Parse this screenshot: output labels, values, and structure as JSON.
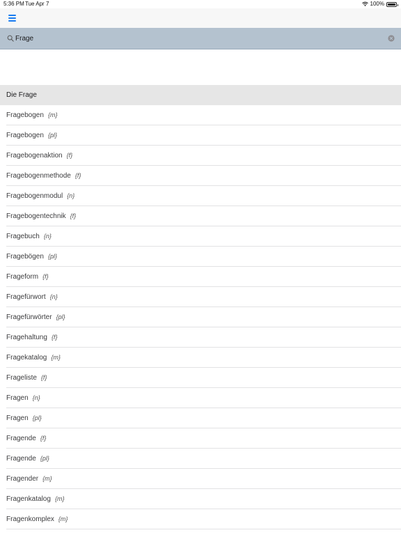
{
  "status_bar": {
    "time": "5:36 PM",
    "date": "Tue Apr 7",
    "battery": "100%"
  },
  "search": {
    "value": "Frage",
    "placeholder": ""
  },
  "section_title": "Die Frage",
  "results": [
    {
      "word": "Fragebogen",
      "gender": "{m}"
    },
    {
      "word": "Fragebogen",
      "gender": "{pl}"
    },
    {
      "word": "Fragebogenaktion",
      "gender": "{f}"
    },
    {
      "word": "Fragebogenmethode",
      "gender": "{f}"
    },
    {
      "word": "Fragebogenmodul",
      "gender": "{n}"
    },
    {
      "word": "Fragebogentechnik",
      "gender": "{f}"
    },
    {
      "word": "Fragebuch",
      "gender": "{n}"
    },
    {
      "word": "Fragebögen",
      "gender": "{pl}"
    },
    {
      "word": "Frageform",
      "gender": "{f}"
    },
    {
      "word": "Fragefürwort",
      "gender": "{n}"
    },
    {
      "word": "Fragefürwörter",
      "gender": "{pl}"
    },
    {
      "word": "Fragehaltung",
      "gender": "{f}"
    },
    {
      "word": "Fragekatalog",
      "gender": "{m}"
    },
    {
      "word": "Frageliste",
      "gender": "{f}"
    },
    {
      "word": "Fragen",
      "gender": "{n}"
    },
    {
      "word": "Fragen",
      "gender": "{pl}"
    },
    {
      "word": "Fragende",
      "gender": "{f}"
    },
    {
      "word": "Fragende",
      "gender": "{pl}"
    },
    {
      "word": "Fragender",
      "gender": "{m}"
    },
    {
      "word": "Fragenkatalog",
      "gender": "{m}"
    },
    {
      "word": "Fragenkomplex",
      "gender": "{m}"
    }
  ],
  "colors": {
    "accent": "#1a7cf1",
    "search_bar": "#b4c2cf",
    "section_header": "#e6e6e6"
  },
  "icons": [
    "wifi-icon",
    "battery-icon",
    "menu-icon",
    "search-icon",
    "clear-icon"
  ]
}
